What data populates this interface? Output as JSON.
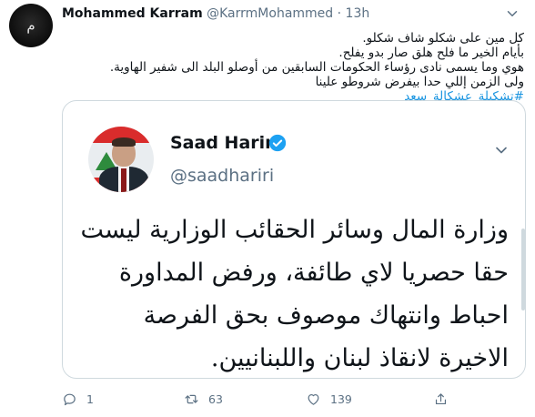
{
  "author": {
    "name": "Mohammed Karram",
    "handle": "@KarrmMohammed",
    "separator": "·",
    "time": "13h"
  },
  "tweet": {
    "lines": [
      "كل مين على شكلو شاف شكلو.",
      "بأيام الخير ما فلح هلق صار بدو يفلح.",
      "هوي وما يسمى نادى رؤساء الحكومات السابقين من أوصلو البلد الى شفير الهاوية.",
      "ولى الزمن إللي حدا بيفرض شروطو علينا"
    ],
    "hashtag": "#تشكيلة_عشكالة_سعد"
  },
  "quoted": {
    "name": "Saad Hariri",
    "handle": "@saadhariri",
    "lines": [
      "وزارة المال وسائر الحقائب الوزارية ليست",
      "حقا حصريا لاي طائفة، ورفض المداورة",
      "احباط وانتهاك موصوف بحق الفرصة",
      "الاخيرة لانقاذ لبنان واللبنانيين."
    ]
  },
  "actions": {
    "reply_count": "1",
    "retweet_count": "63",
    "like_count": "139"
  },
  "icons": {
    "reply": "reply-icon",
    "retweet": "retweet-icon",
    "like": "heart-icon",
    "share": "share-icon",
    "verified": "verified-badge-icon"
  },
  "colors": {
    "link": "#1b95e0",
    "secondary": "#5b7083",
    "verified": "#1da1f2"
  }
}
